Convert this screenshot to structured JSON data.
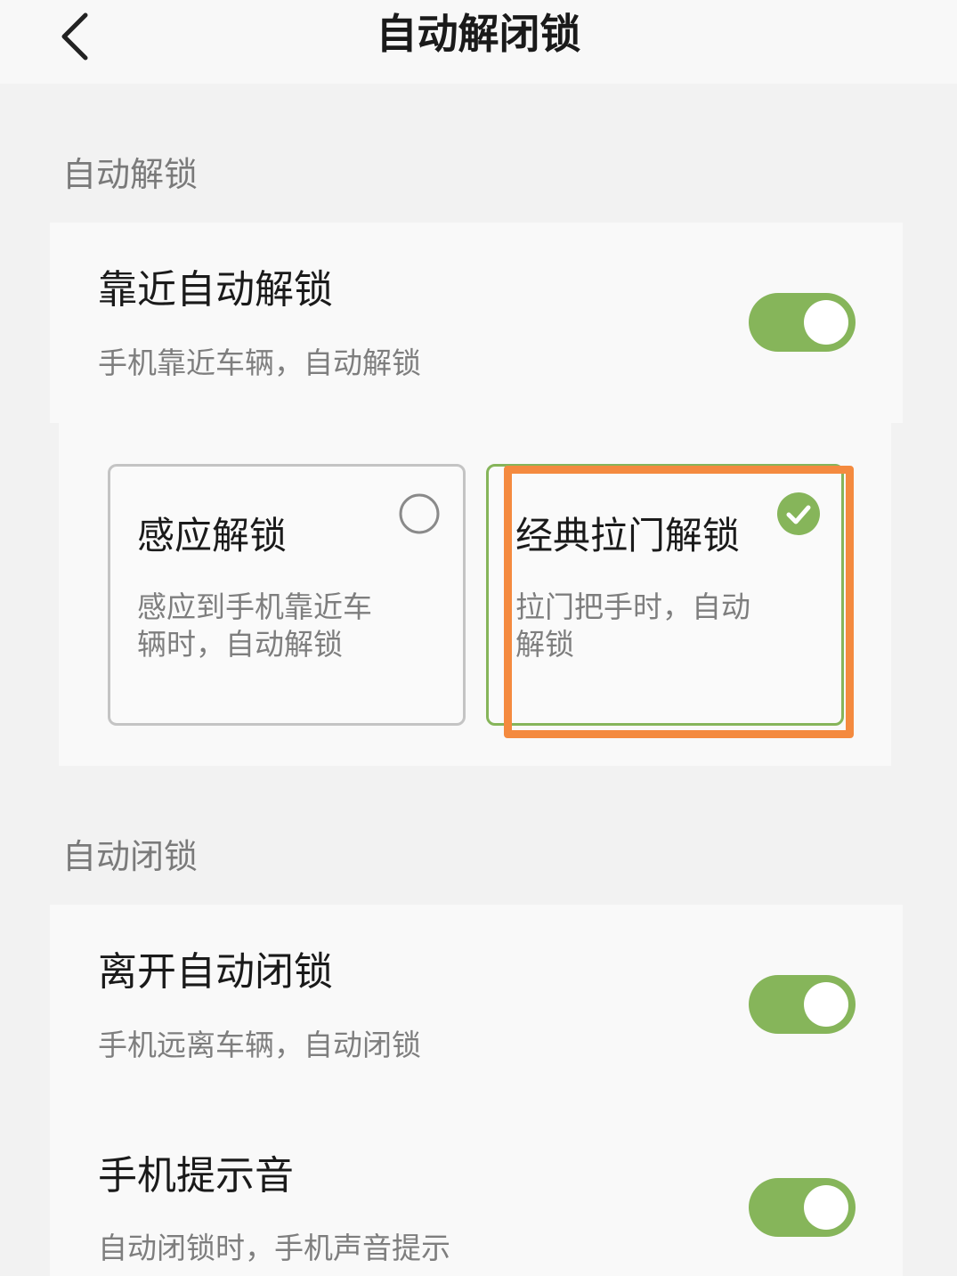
{
  "header": {
    "back_icon": "chevron-left-icon",
    "title": "自动解闭锁"
  },
  "unlock_section": {
    "title": "自动解锁",
    "row": {
      "title": "靠近自动解锁",
      "desc": "手机靠近车辆，自动解锁",
      "toggle_on": true
    },
    "options": [
      {
        "title": "感应解锁",
        "desc_line1": "感应到手机靠近车",
        "desc_line2": "辆时，自动解锁",
        "selected": false,
        "icon": "radio-unchecked-icon"
      },
      {
        "title": "经典拉门解锁",
        "desc_line1": "拉门把手时，自动",
        "desc_line2": "解锁",
        "selected": true,
        "icon": "check-circle-icon"
      }
    ]
  },
  "lock_section": {
    "title": "自动闭锁",
    "rows": [
      {
        "title": "离开自动闭锁",
        "desc": "手机远离车辆，自动闭锁",
        "toggle_on": true
      },
      {
        "title": "手机提示音",
        "desc": "自动闭锁时，手机声音提示",
        "toggle_on": true
      }
    ]
  },
  "colors": {
    "toggle_on": "#86b55a",
    "selected_border": "#86b55a",
    "highlight": "#f48a3f",
    "background": "#f2f2f2"
  }
}
